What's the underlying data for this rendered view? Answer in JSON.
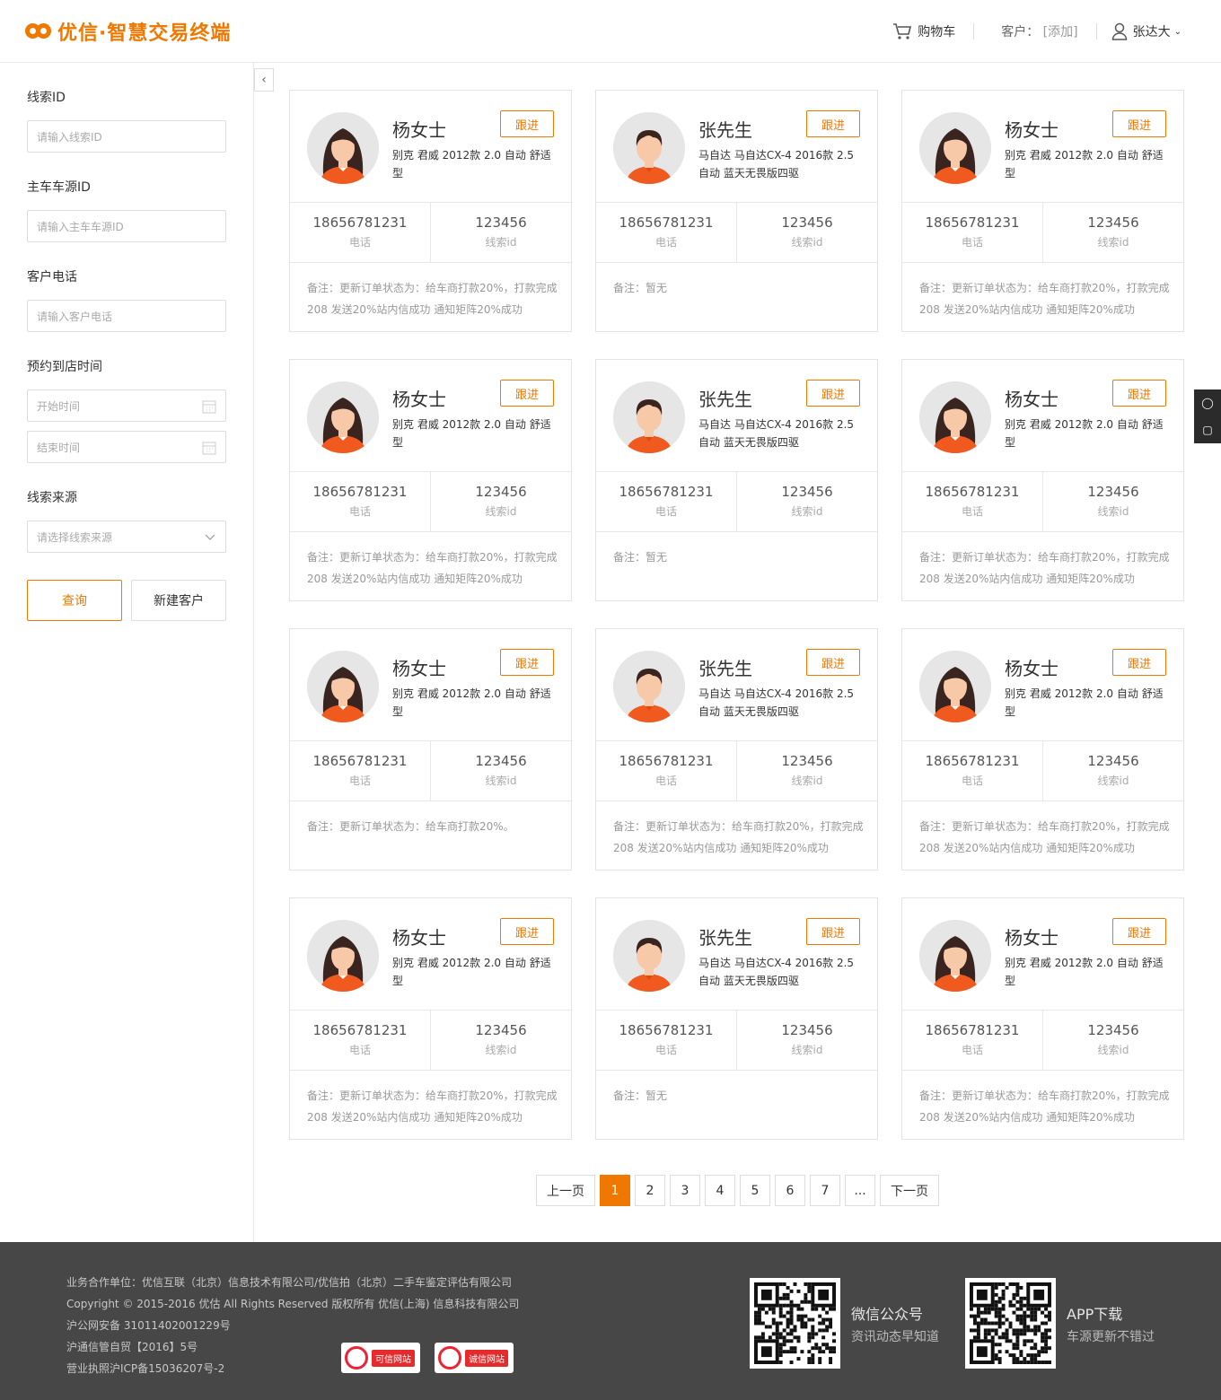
{
  "header": {
    "logo_text": "优信·智慧交易终端",
    "cart_label": "购物车",
    "customer_label": "客户：",
    "customer_add": "[添加]",
    "user_name": "张达大"
  },
  "filters": {
    "clue_id_label": "线索ID",
    "clue_id_placeholder": "请输入线索ID",
    "car_source_label": "主车车源ID",
    "car_source_placeholder": "请输入主车车源ID",
    "phone_label": "客户电话",
    "phone_placeholder": "请输入客户电话",
    "visit_time_label": "预约到店时间",
    "start_placeholder": "开始时间",
    "end_placeholder": "结束时间",
    "source_label": "线索来源",
    "source_placeholder": "请选择线索来源",
    "query_label": "查询",
    "new_customer_label": "新建客户"
  },
  "cards": [
    {
      "name": "杨女士",
      "gender": "female",
      "car": "别克 君威 2012款 2.0 自动 舒适型",
      "phone": "18656781231",
      "phone_label": "电话",
      "clue_id": "123456",
      "clue_label": "线索id",
      "note": "备注：更新订单状态为：给车商打款20%，打款完成208 发送20%站内信成功 通知矩阵20%成功",
      "follow": "跟进"
    },
    {
      "name": "张先生",
      "gender": "male",
      "car": "马自达 马自达CX-4 2016款 2.5 自动 蓝天无畏版四驱",
      "phone": "18656781231",
      "phone_label": "电话",
      "clue_id": "123456",
      "clue_label": "线索id",
      "note": "备注：暂无",
      "follow": "跟进"
    },
    {
      "name": "杨女士",
      "gender": "female",
      "car": "别克 君威 2012款 2.0 自动 舒适型",
      "phone": "18656781231",
      "phone_label": "电话",
      "clue_id": "123456",
      "clue_label": "线索id",
      "note": "备注：更新订单状态为：给车商打款20%，打款完成208 发送20%站内信成功 通知矩阵20%成功",
      "follow": "跟进"
    },
    {
      "name": "杨女士",
      "gender": "female",
      "car": "别克 君威 2012款 2.0 自动 舒适型",
      "phone": "18656781231",
      "phone_label": "电话",
      "clue_id": "123456",
      "clue_label": "线索id",
      "note": "备注：更新订单状态为：给车商打款20%，打款完成208 发送20%站内信成功 通知矩阵20%成功",
      "follow": "跟进"
    },
    {
      "name": "张先生",
      "gender": "male",
      "car": "马自达 马自达CX-4 2016款 2.5 自动 蓝天无畏版四驱",
      "phone": "18656781231",
      "phone_label": "电话",
      "clue_id": "123456",
      "clue_label": "线索id",
      "note": "备注：暂无",
      "follow": "跟进"
    },
    {
      "name": "杨女士",
      "gender": "female",
      "car": "别克 君威 2012款 2.0 自动 舒适型",
      "phone": "18656781231",
      "phone_label": "电话",
      "clue_id": "123456",
      "clue_label": "线索id",
      "note": "备注：更新订单状态为：给车商打款20%，打款完成208 发送20%站内信成功 通知矩阵20%成功",
      "follow": "跟进"
    },
    {
      "name": "杨女士",
      "gender": "female",
      "car": "别克 君威 2012款 2.0 自动 舒适型",
      "phone": "18656781231",
      "phone_label": "电话",
      "clue_id": "123456",
      "clue_label": "线索id",
      "note": "备注：更新订单状态为：给车商打款20%。",
      "follow": "跟进"
    },
    {
      "name": "张先生",
      "gender": "male",
      "car": "马自达 马自达CX-4 2016款 2.5 自动 蓝天无畏版四驱",
      "phone": "18656781231",
      "phone_label": "电话",
      "clue_id": "123456",
      "clue_label": "线索id",
      "note": "备注：更新订单状态为：给车商打款20%，打款完成208 发送20%站内信成功 通知矩阵20%成功",
      "follow": "跟进"
    },
    {
      "name": "杨女士",
      "gender": "female",
      "car": "别克 君威 2012款 2.0 自动 舒适型",
      "phone": "18656781231",
      "phone_label": "电话",
      "clue_id": "123456",
      "clue_label": "线索id",
      "note": "备注：更新订单状态为：给车商打款20%，打款完成208 发送20%站内信成功 通知矩阵20%成功",
      "follow": "跟进"
    },
    {
      "name": "杨女士",
      "gender": "female",
      "car": "别克 君威 2012款 2.0 自动 舒适型",
      "phone": "18656781231",
      "phone_label": "电话",
      "clue_id": "123456",
      "clue_label": "线索id",
      "note": "备注：更新订单状态为：给车商打款20%，打款完成208 发送20%站内信成功 通知矩阵20%成功",
      "follow": "跟进"
    },
    {
      "name": "张先生",
      "gender": "male",
      "car": "马自达 马自达CX-4 2016款 2.5 自动 蓝天无畏版四驱",
      "phone": "18656781231",
      "phone_label": "电话",
      "clue_id": "123456",
      "clue_label": "线索id",
      "note": "备注：暂无",
      "follow": "跟进"
    },
    {
      "name": "杨女士",
      "gender": "female",
      "car": "别克 君威 2012款 2.0 自动 舒适型",
      "phone": "18656781231",
      "phone_label": "电话",
      "clue_id": "123456",
      "clue_label": "线索id",
      "note": "备注：更新订单状态为：给车商打款20%，打款完成208 发送20%站内信成功 通知矩阵20%成功",
      "follow": "跟进"
    }
  ],
  "pagination": {
    "prev": "上一页",
    "pages": [
      "1",
      "2",
      "3",
      "4",
      "5",
      "6",
      "7",
      "..."
    ],
    "active": "1",
    "next": "下一页"
  },
  "footer": {
    "lines": [
      "业务合作单位：优信互联（北京）信息技术有限公司/优信拍（北京）二手车鉴定评估有限公司",
      "Copyright © 2015-2016 优估 All Rights Reserved    版权所有 优信(上海) 信息科技有限公司",
      "沪公网安备 31011402001229号",
      "沪通信管自贸【2016】5号",
      "营业执照沪ICP备15036207号-2"
    ],
    "badge1": "可信网站",
    "badge2": "诚信网站",
    "wechat_title": "微信公众号",
    "wechat_sub": "资讯动态早知道",
    "app_title": "APP下载",
    "app_sub": "车源更新不错过"
  },
  "colors": {
    "accent": "#f07800",
    "footer_bg": "#474747"
  }
}
